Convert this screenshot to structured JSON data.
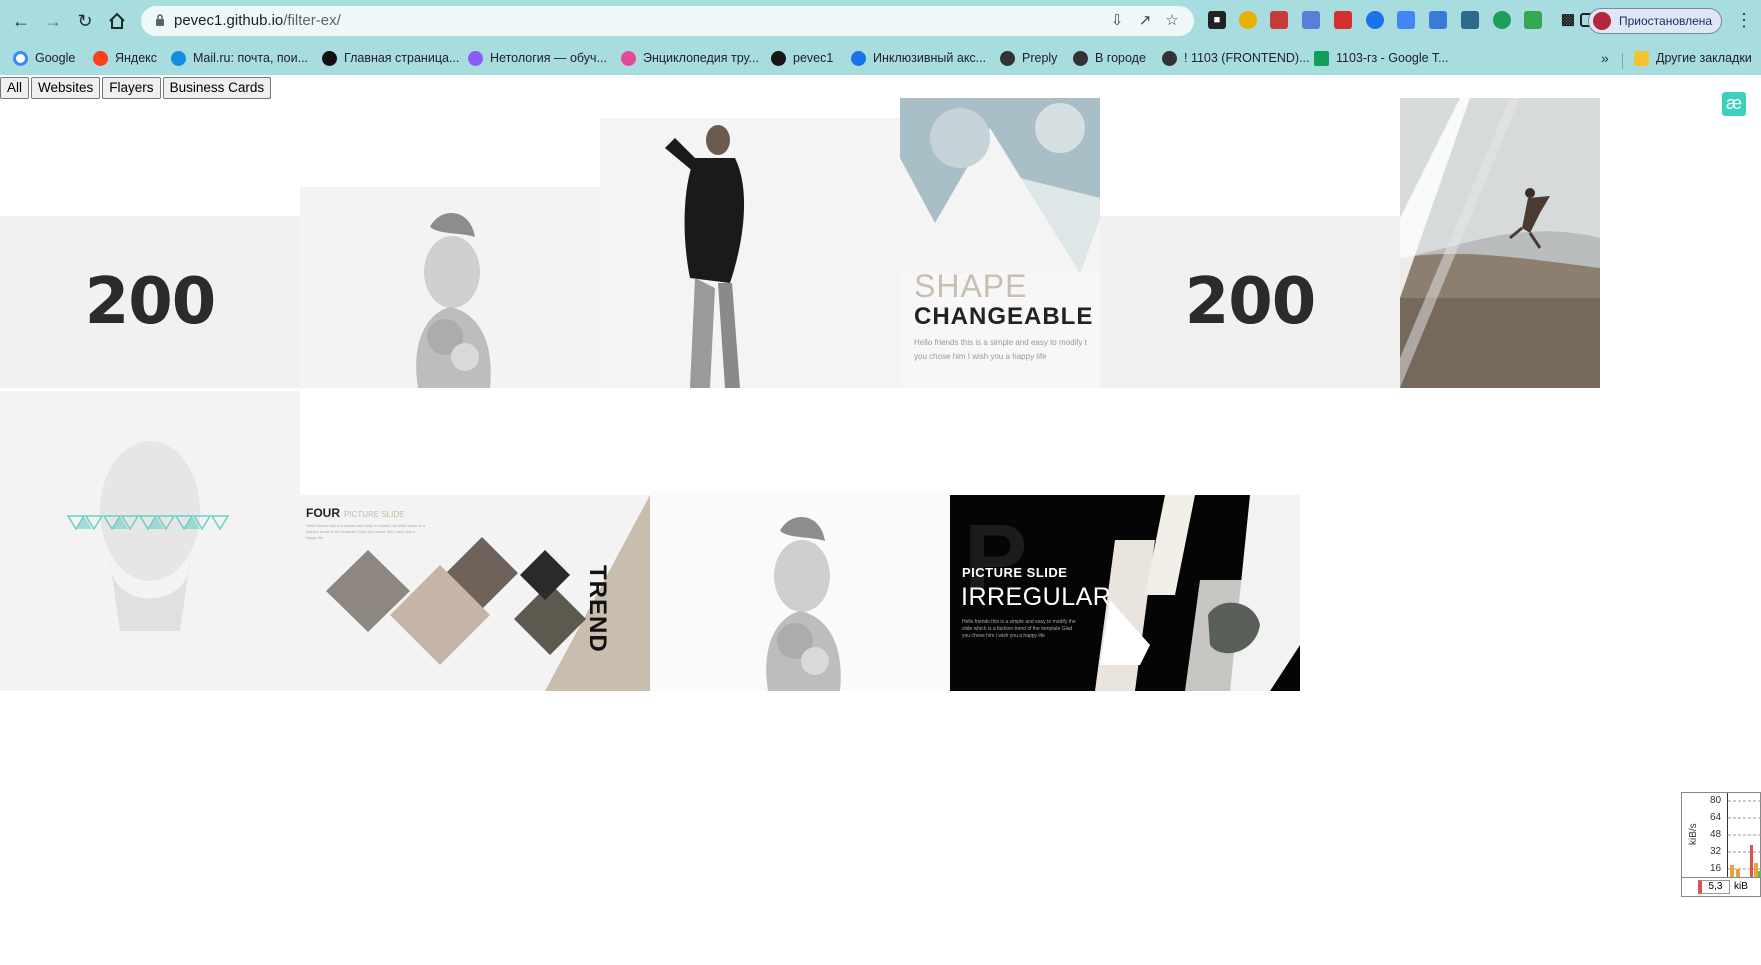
{
  "browser": {
    "url_host": "pevec1.github.io",
    "url_path": "/filter-ex/",
    "profile_label": "Приостановлена"
  },
  "bookmarks": [
    {
      "label": "Google",
      "color": "#4285f4"
    },
    {
      "label": "Яндекс",
      "color": "#fc3f1d"
    },
    {
      "label": "Mail.ru: почта, пои...",
      "color": "#168de2"
    },
    {
      "label": "Главная страница...",
      "color": "#111111"
    },
    {
      "label": "Нетология — обуч...",
      "color": "#8b5cf6"
    },
    {
      "label": "Энциклопедия тру...",
      "color": "#e5489a"
    },
    {
      "label": "pevec1",
      "color": "#181717"
    },
    {
      "label": "Инклюзивный акс...",
      "color": "#1a73e8"
    },
    {
      "label": "Preply",
      "color": "#333333"
    },
    {
      "label": "В городе",
      "color": "#333333"
    },
    {
      "label": "! 1103 (FRONTEND)...",
      "color": "#333333"
    },
    {
      "label": "1103-гз - Google T...",
      "color": "#0f9d58"
    }
  ],
  "bookmarks_other": "Другие закладки",
  "filters": [
    "All",
    "Websites",
    "Flayers",
    "Business Cards"
  ],
  "tiles": {
    "num_200": "200",
    "shape_title1": "SHAPE",
    "shape_title2": "CHANGEABLE",
    "shape_body": "Hello friends this is a simple and easy to modify t you chose him I wish you a happy life",
    "four_title": "FOUR",
    "four_sub": "PICTURE SLIDE",
    "trend": "TREND",
    "irregular_title1": "PICTURE SLIDE",
    "irregular_title2": "IRREGULAR",
    "irregular_body": "Hello friends this is a simple and easy to modify the slide which is a fashion trend of the template Glad you chose him I wish you a happy life"
  },
  "netmon": {
    "y_ticks": [
      "80",
      "64",
      "48",
      "32",
      "16"
    ],
    "y_label": "kiB/s",
    "value": "5,3",
    "unit": "kiB"
  }
}
